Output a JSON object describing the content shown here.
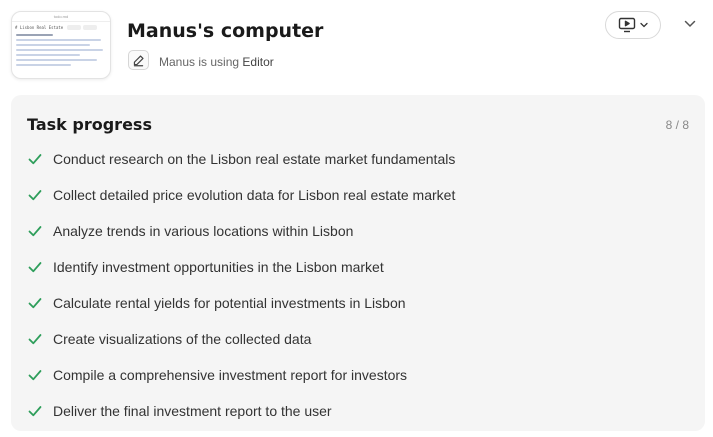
{
  "header": {
    "title": "Manus's computer",
    "status_prefix": "Manus is using",
    "status_app": "Editor"
  },
  "thumbnail": {
    "window_title": "todo.md",
    "file_label": "# Lisbon Real Estate"
  },
  "progress": {
    "heading": "Task progress",
    "counter": "8 / 8",
    "completed": 8,
    "total": 8
  },
  "tasks": [
    {
      "label": "Conduct research on the Lisbon real estate market fundamentals",
      "done": true
    },
    {
      "label": "Collect detailed price evolution data for Lisbon real estate market",
      "done": true
    },
    {
      "label": "Analyze trends in various locations within Lisbon",
      "done": true
    },
    {
      "label": "Identify investment opportunities in the Lisbon market",
      "done": true
    },
    {
      "label": "Calculate rental yields for potential investments in Lisbon",
      "done": true
    },
    {
      "label": "Create visualizations of the collected data",
      "done": true
    },
    {
      "label": "Compile a comprehensive investment report for investors",
      "done": true
    },
    {
      "label": "Deliver the final investment report to the user",
      "done": true
    }
  ],
  "colors": {
    "check": "#2e9e5b",
    "panel_bg": "#f5f5f5"
  },
  "icons": {
    "editor": "pencil-square-icon",
    "screen": "monitor-play-icon",
    "dropdown": "chevron-down-icon",
    "collapse": "chevron-down-icon",
    "task_status": "check-icon"
  }
}
